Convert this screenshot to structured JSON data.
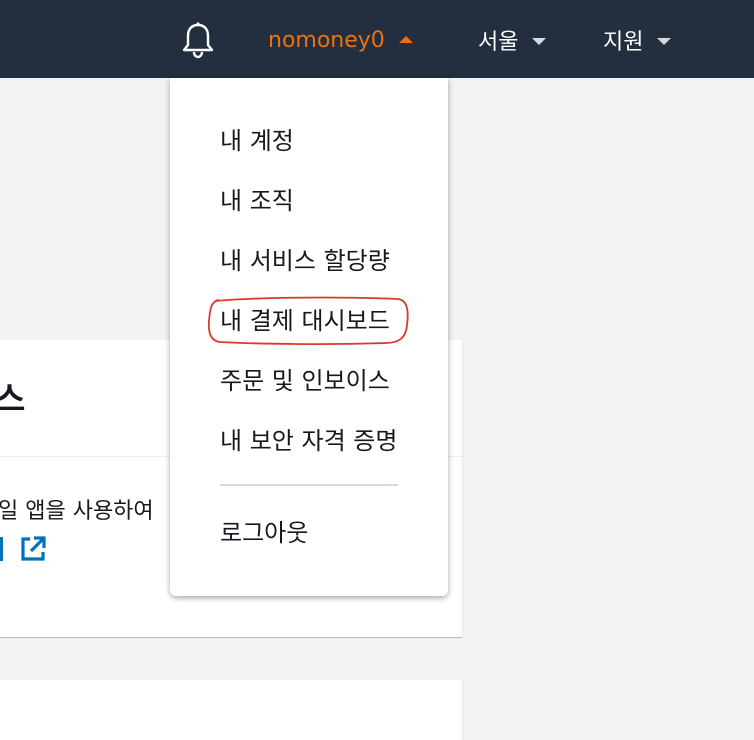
{
  "topbar": {
    "bell_icon": "bell-icon",
    "account_name": "nomoney0",
    "region_label": "서울",
    "support_label": "지원",
    "colors": {
      "background": "#232f3e",
      "account_accent": "#ec7211",
      "text": "#ffffff"
    }
  },
  "account_menu": {
    "items": [
      {
        "label": "내 계정"
      },
      {
        "label": "내 조직"
      },
      {
        "label": "내 서비스 할당량"
      },
      {
        "label": "내 결제 대시보드",
        "highlighted": true
      },
      {
        "label": "주문 및 인보이스"
      },
      {
        "label": "내 보안 자격 증명"
      }
    ],
    "logout_label": "로그아웃",
    "highlight_color": "#d93a2b"
  },
  "background_panel": {
    "title_fragment": "스",
    "text_fragment": "일 앱을 사용하여",
    "link_fragment": "",
    "external_link_icon": "external-link-icon",
    "link_color": "#0073bb"
  }
}
